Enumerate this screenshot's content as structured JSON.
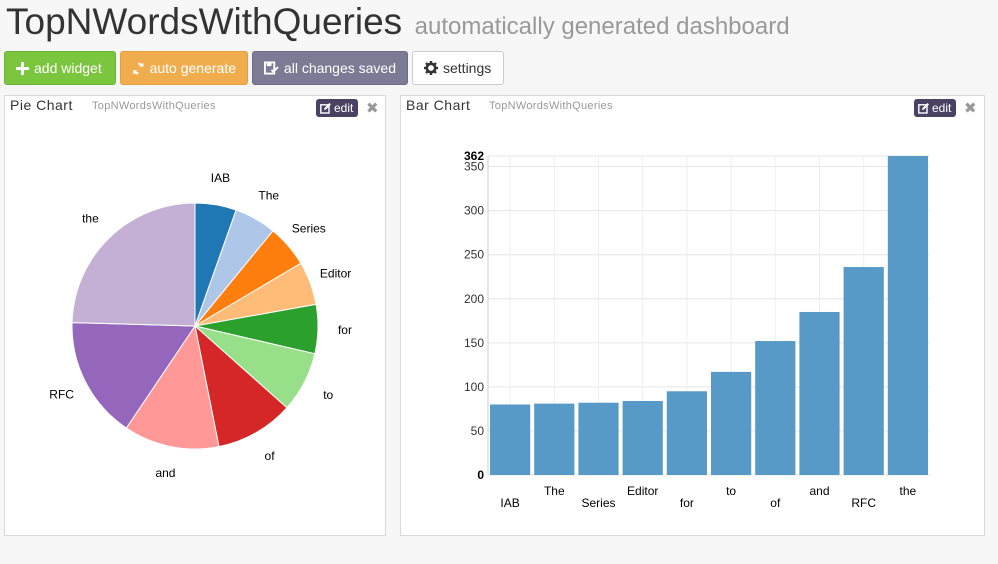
{
  "header": {
    "title": "TopNWordsWithQueries",
    "subtitle": "automatically generated dashboard"
  },
  "toolbar": {
    "add_widget": "add widget",
    "auto_generate": "auto generate",
    "changes_saved": "all changes saved",
    "settings": "settings"
  },
  "widgets": [
    {
      "title": "Pie Chart",
      "subtitle": "TopNWordsWithQueries",
      "edit_label": "edit",
      "close_icon": "close-icon"
    },
    {
      "title": "Bar Chart",
      "subtitle": "TopNWordsWithQueries",
      "edit_label": "edit",
      "close_icon": "close-icon"
    }
  ],
  "chart_data": [
    {
      "type": "pie",
      "categories": [
        "IAB",
        "The",
        "Series",
        "Editor",
        "for",
        "to",
        "of",
        "and",
        "RFC",
        "the"
      ],
      "values": [
        80,
        81,
        82,
        84,
        95,
        117,
        152,
        185,
        236,
        362
      ],
      "colors": [
        "#1f77b4",
        "#aec7e8",
        "#ff7f0e",
        "#ffbb78",
        "#2ca02c",
        "#98df8a",
        "#d62728",
        "#ff9896",
        "#9467bd",
        "#c5b0d5"
      ]
    },
    {
      "type": "bar",
      "categories": [
        "IAB",
        "The",
        "Series",
        "Editor",
        "for",
        "to",
        "of",
        "and",
        "RFC",
        "the"
      ],
      "values": [
        80,
        81,
        82,
        84,
        95,
        117,
        152,
        185,
        236,
        362
      ],
      "color": "#5799c7",
      "ylim": [
        0,
        362
      ],
      "yticks": [
        0,
        50,
        100,
        150,
        200,
        250,
        300,
        350,
        362
      ],
      "grid": true
    }
  ]
}
